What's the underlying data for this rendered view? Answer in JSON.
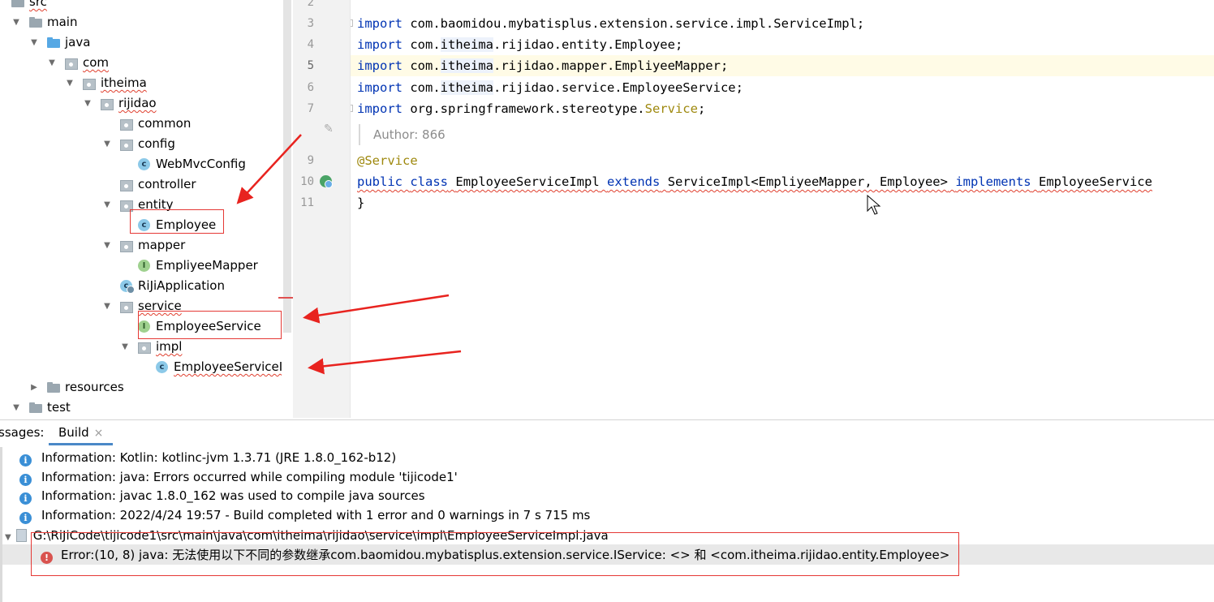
{
  "tree": {
    "items": [
      {
        "label": "src",
        "icon": "folder-icon",
        "arrow": "",
        "squig": true
      },
      {
        "label": "main",
        "icon": "folder-icon",
        "arrow": "▼",
        "squig": false
      },
      {
        "label": "java",
        "icon": "source-folder-icon",
        "arrow": "▼",
        "squig": false
      },
      {
        "label": "com",
        "icon": "package-icon",
        "arrow": "▼",
        "squig": true
      },
      {
        "label": "itheima",
        "icon": "package-icon",
        "arrow": "▼",
        "squig": true
      },
      {
        "label": "rijidao",
        "icon": "package-icon",
        "arrow": "▼",
        "squig": true
      },
      {
        "label": "common",
        "icon": "package-icon",
        "arrow": "",
        "squig": false
      },
      {
        "label": "config",
        "icon": "package-icon",
        "arrow": "▼",
        "squig": false
      },
      {
        "label": "WebMvcConfig",
        "icon": "class-icon",
        "arrow": "",
        "squig": false
      },
      {
        "label": "controller",
        "icon": "package-icon",
        "arrow": "",
        "squig": false
      },
      {
        "label": "entity",
        "icon": "package-icon",
        "arrow": "▼",
        "squig": false
      },
      {
        "label": "Employee",
        "icon": "class-icon",
        "arrow": "",
        "squig": false
      },
      {
        "label": "mapper",
        "icon": "package-icon",
        "arrow": "▼",
        "squig": false
      },
      {
        "label": "EmpliyeeMapper",
        "icon": "interface-icon",
        "arrow": "",
        "squig": false
      },
      {
        "label": "RiJiApplication",
        "icon": "spring-app-icon",
        "arrow": "",
        "squig": false
      },
      {
        "label": "service",
        "icon": "package-icon",
        "arrow": "▼",
        "squig": true
      },
      {
        "label": "EmployeeService",
        "icon": "interface-icon",
        "arrow": "",
        "squig": false
      },
      {
        "label": "impl",
        "icon": "package-icon",
        "arrow": "▼",
        "squig": true
      },
      {
        "label": "EmployeeServiceIm",
        "icon": "class-icon",
        "arrow": "",
        "squig": true
      },
      {
        "label": "resources",
        "icon": "folder-icon",
        "arrow": "▶",
        "squig": false
      },
      {
        "label": "test",
        "icon": "folder-icon",
        "arrow": "▼",
        "squig": false
      }
    ]
  },
  "editor": {
    "line_numbers": [
      "2",
      "3",
      "4",
      "5",
      "6",
      "7",
      "9",
      "10",
      "11"
    ],
    "imports": [
      {
        "kw": "import",
        "pre": " com.baomidou.mybatisplus.extension.service.impl.ServiceImpl;",
        "hl": "",
        "post": ""
      },
      {
        "kw": "import",
        "pre": " com.",
        "hl": "itheima",
        "post": ".rijidao.entity.Employee;"
      },
      {
        "kw": "import",
        "pre": " com.",
        "hl": "itheima",
        "post": ".rijidao.mapper.EmpliyeeMapper;"
      },
      {
        "kw": "import",
        "pre": " com.",
        "hl": "itheima",
        "post": ".rijidao.service.EmployeeService;"
      },
      {
        "kw": "import",
        "pre": " org.springframework.stereotype.",
        "hl": "",
        "post": "",
        "ann": "Service",
        "tail": ";"
      }
    ],
    "author": "Author: 866",
    "annotation": "@Service",
    "class_decl": {
      "kw1": "public",
      "kw2": "class",
      "name": "EmployeeServiceImpl",
      "kw3": "extends",
      "base": "ServiceImpl<EmpliyeeMapper, Employee>",
      "kw4": "implements",
      "iface": "EmployeeService"
    },
    "closing": "}"
  },
  "panel": {
    "prefix": "ssages:",
    "tab": "Build",
    "tab_close": "×",
    "messages": [
      "Information: Kotlin: kotlinc-jvm 1.3.71 (JRE 1.8.0_162-b12)",
      "Information: java: Errors occurred while compiling module 'tijicode1'",
      "Information: javac 1.8.0_162 was used to compile java sources",
      "Information: 2022/4/24 19:57 - Build completed with 1 error and 0 warnings in 7 s 715 ms"
    ],
    "file_path": "G:\\RiJiCode\\tijicode1\\src\\main\\java\\com\\itheima\\rijidao\\service\\impl\\EmployeeServiceImpl.java",
    "error": "Error:(10, 8)  java: 无法使用以下不同的参数继承com.baomidou.mybatisplus.extension.service.IService: <> 和 <com.itheima.rijidao.entity.Employee>"
  },
  "colors": {
    "keyword": "#0033b3",
    "annotation": "#9e880d",
    "error": "#e53935",
    "accent": "#4a88c7"
  }
}
